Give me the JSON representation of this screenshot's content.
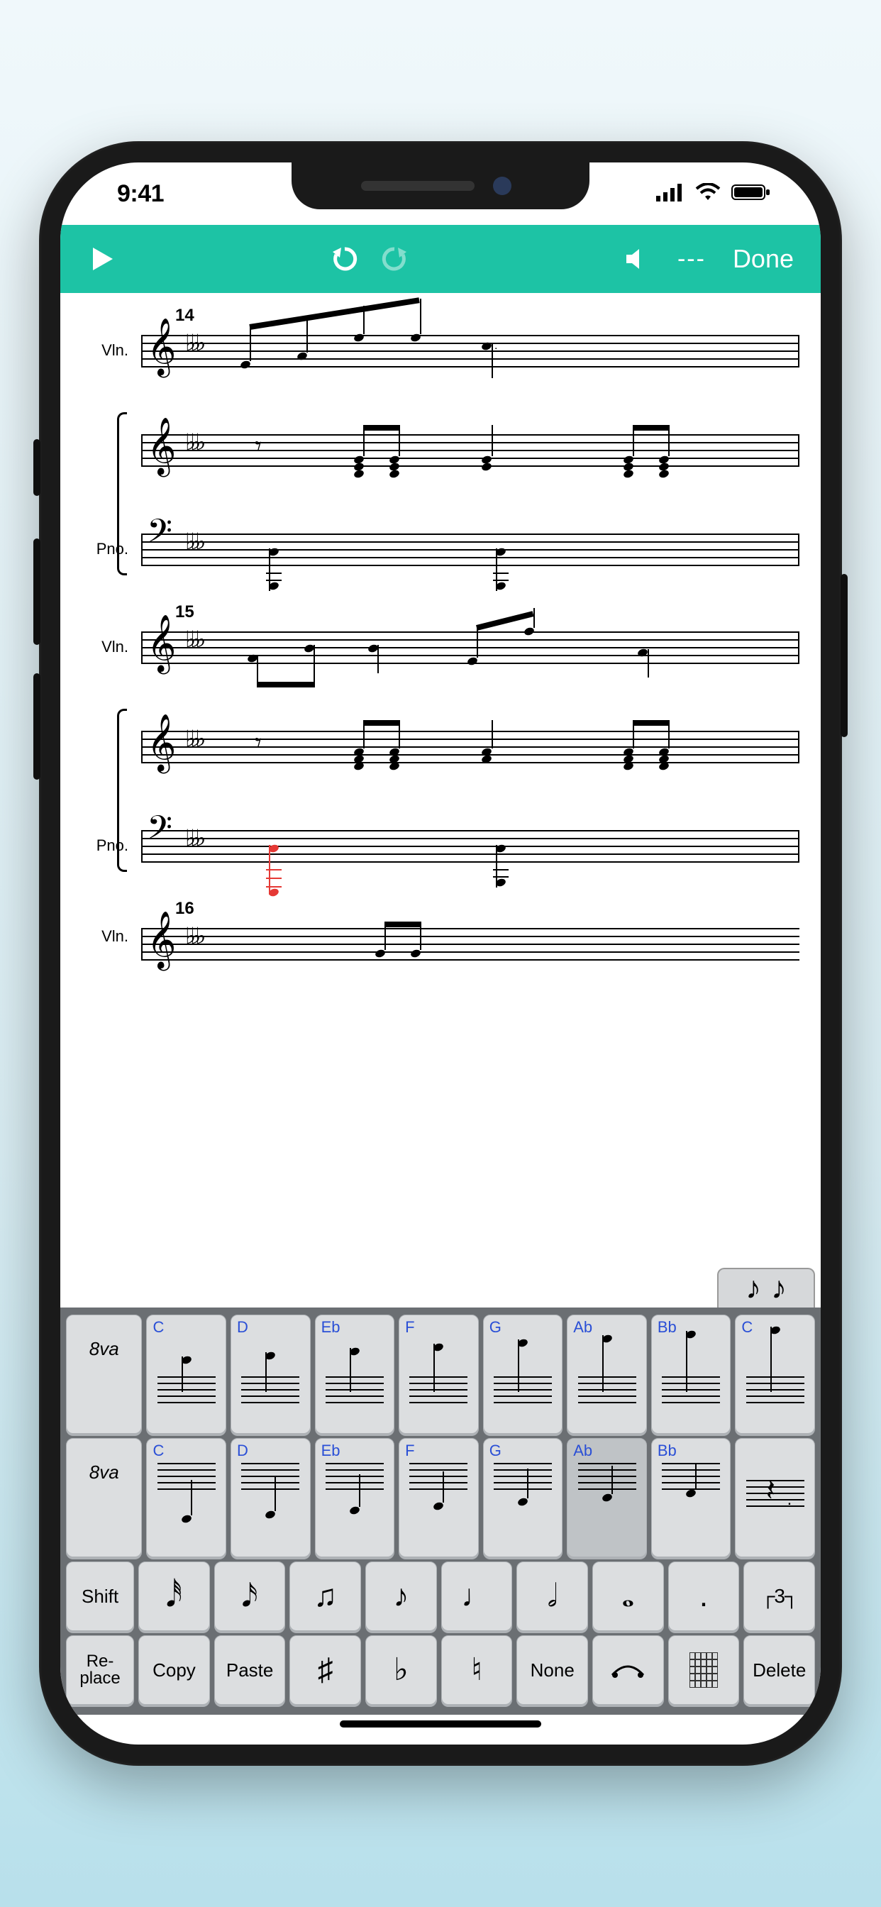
{
  "status": {
    "time": "9:41"
  },
  "toolbar": {
    "tempo": "---",
    "done": "Done"
  },
  "score": {
    "measures": [
      {
        "number": "14",
        "instruments": {
          "violin_label": "Vln.",
          "piano_label": "Pno."
        }
      },
      {
        "number": "15",
        "instruments": {
          "violin_label": "Vln.",
          "piano_label": "Pno."
        }
      },
      {
        "number": "16",
        "instruments": {
          "violin_label": "Vln."
        }
      }
    ],
    "selected": {
      "measure": 15,
      "staff": "piano_bass",
      "beat": 1
    }
  },
  "keyboard": {
    "duration_tab_glyphs": "♪ ♪",
    "ottava": "8va",
    "pitch_row1": [
      "C",
      "D",
      "Eb",
      "F",
      "G",
      "Ab",
      "Bb",
      "C"
    ],
    "pitch_row2": [
      "C",
      "D",
      "Eb",
      "F",
      "G",
      "Ab",
      "Bb"
    ],
    "rest_glyph": "𝄽",
    "shift": "Shift",
    "durations": {
      "thirty_second": "𝅘𝅥𝅰",
      "sixteenth": "𝅘𝅥𝅯",
      "eighth_beamed": "♫",
      "eighth": "♪",
      "quarter": "♩",
      "half": "𝅗𝅥",
      "whole": "𝅝",
      "dot": ".",
      "tuplet": "┌3┐"
    },
    "actions": {
      "replace": "Re-\nplace",
      "copy": "Copy",
      "paste": "Paste",
      "sharp": "♯",
      "flat": "♭",
      "natural": "♮",
      "none": "None",
      "slur": "slur",
      "chord_grid": "chord",
      "delete": "Delete"
    },
    "active_pitch_index": 5
  }
}
